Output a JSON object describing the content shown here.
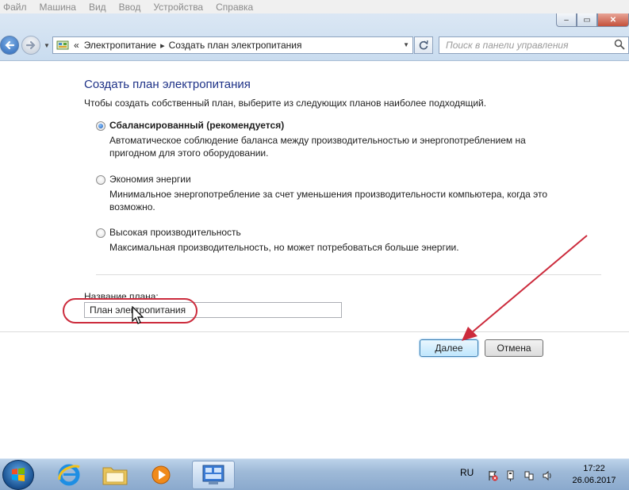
{
  "menubar": {
    "items": [
      "Файл",
      "Машина",
      "Вид",
      "Ввод",
      "Устройства",
      "Справка"
    ]
  },
  "window_controls": {
    "minimize": "‒",
    "maximize": "▭",
    "close": "✕"
  },
  "address_bar": {
    "prefix": "«",
    "crumbs": [
      "Электропитание",
      "Создать план электропитания"
    ],
    "separator": "▸"
  },
  "search": {
    "placeholder": "Поиск в панели управления"
  },
  "page": {
    "title": "Создать план электропитания",
    "subtitle": "Чтобы создать собственный план, выберите из следующих планов наиболее подходящий.",
    "options": [
      {
        "label": "Сбалансированный (рекомендуется)",
        "description": "Автоматическое соблюдение баланса между производительностью и энергопотреблением на пригодном для этого оборудовании.",
        "selected": true
      },
      {
        "label": "Экономия энергии",
        "description": "Минимальное энергопотребление за счет уменьшения производительности компьютера, когда это возможно.",
        "selected": false
      },
      {
        "label": "Высокая производительность",
        "description": "Максимальная производительность, но может потребоваться больше энергии.",
        "selected": false
      }
    ],
    "plan_name_label": "Название плана:",
    "plan_name_value": "План электропитания",
    "next_button": "Далее",
    "cancel_button": "Отмена"
  },
  "annotation": {
    "color": "#cc2b3c"
  },
  "taskbar": {
    "apps": [
      "start-button",
      "internet-explorer",
      "windows-explorer",
      "media-player",
      "control-panel"
    ],
    "language": "RU",
    "time": "17:22",
    "date": "26.06.2017"
  },
  "colors": {
    "title": "#1e3287",
    "accent": "#3c7fb1"
  }
}
